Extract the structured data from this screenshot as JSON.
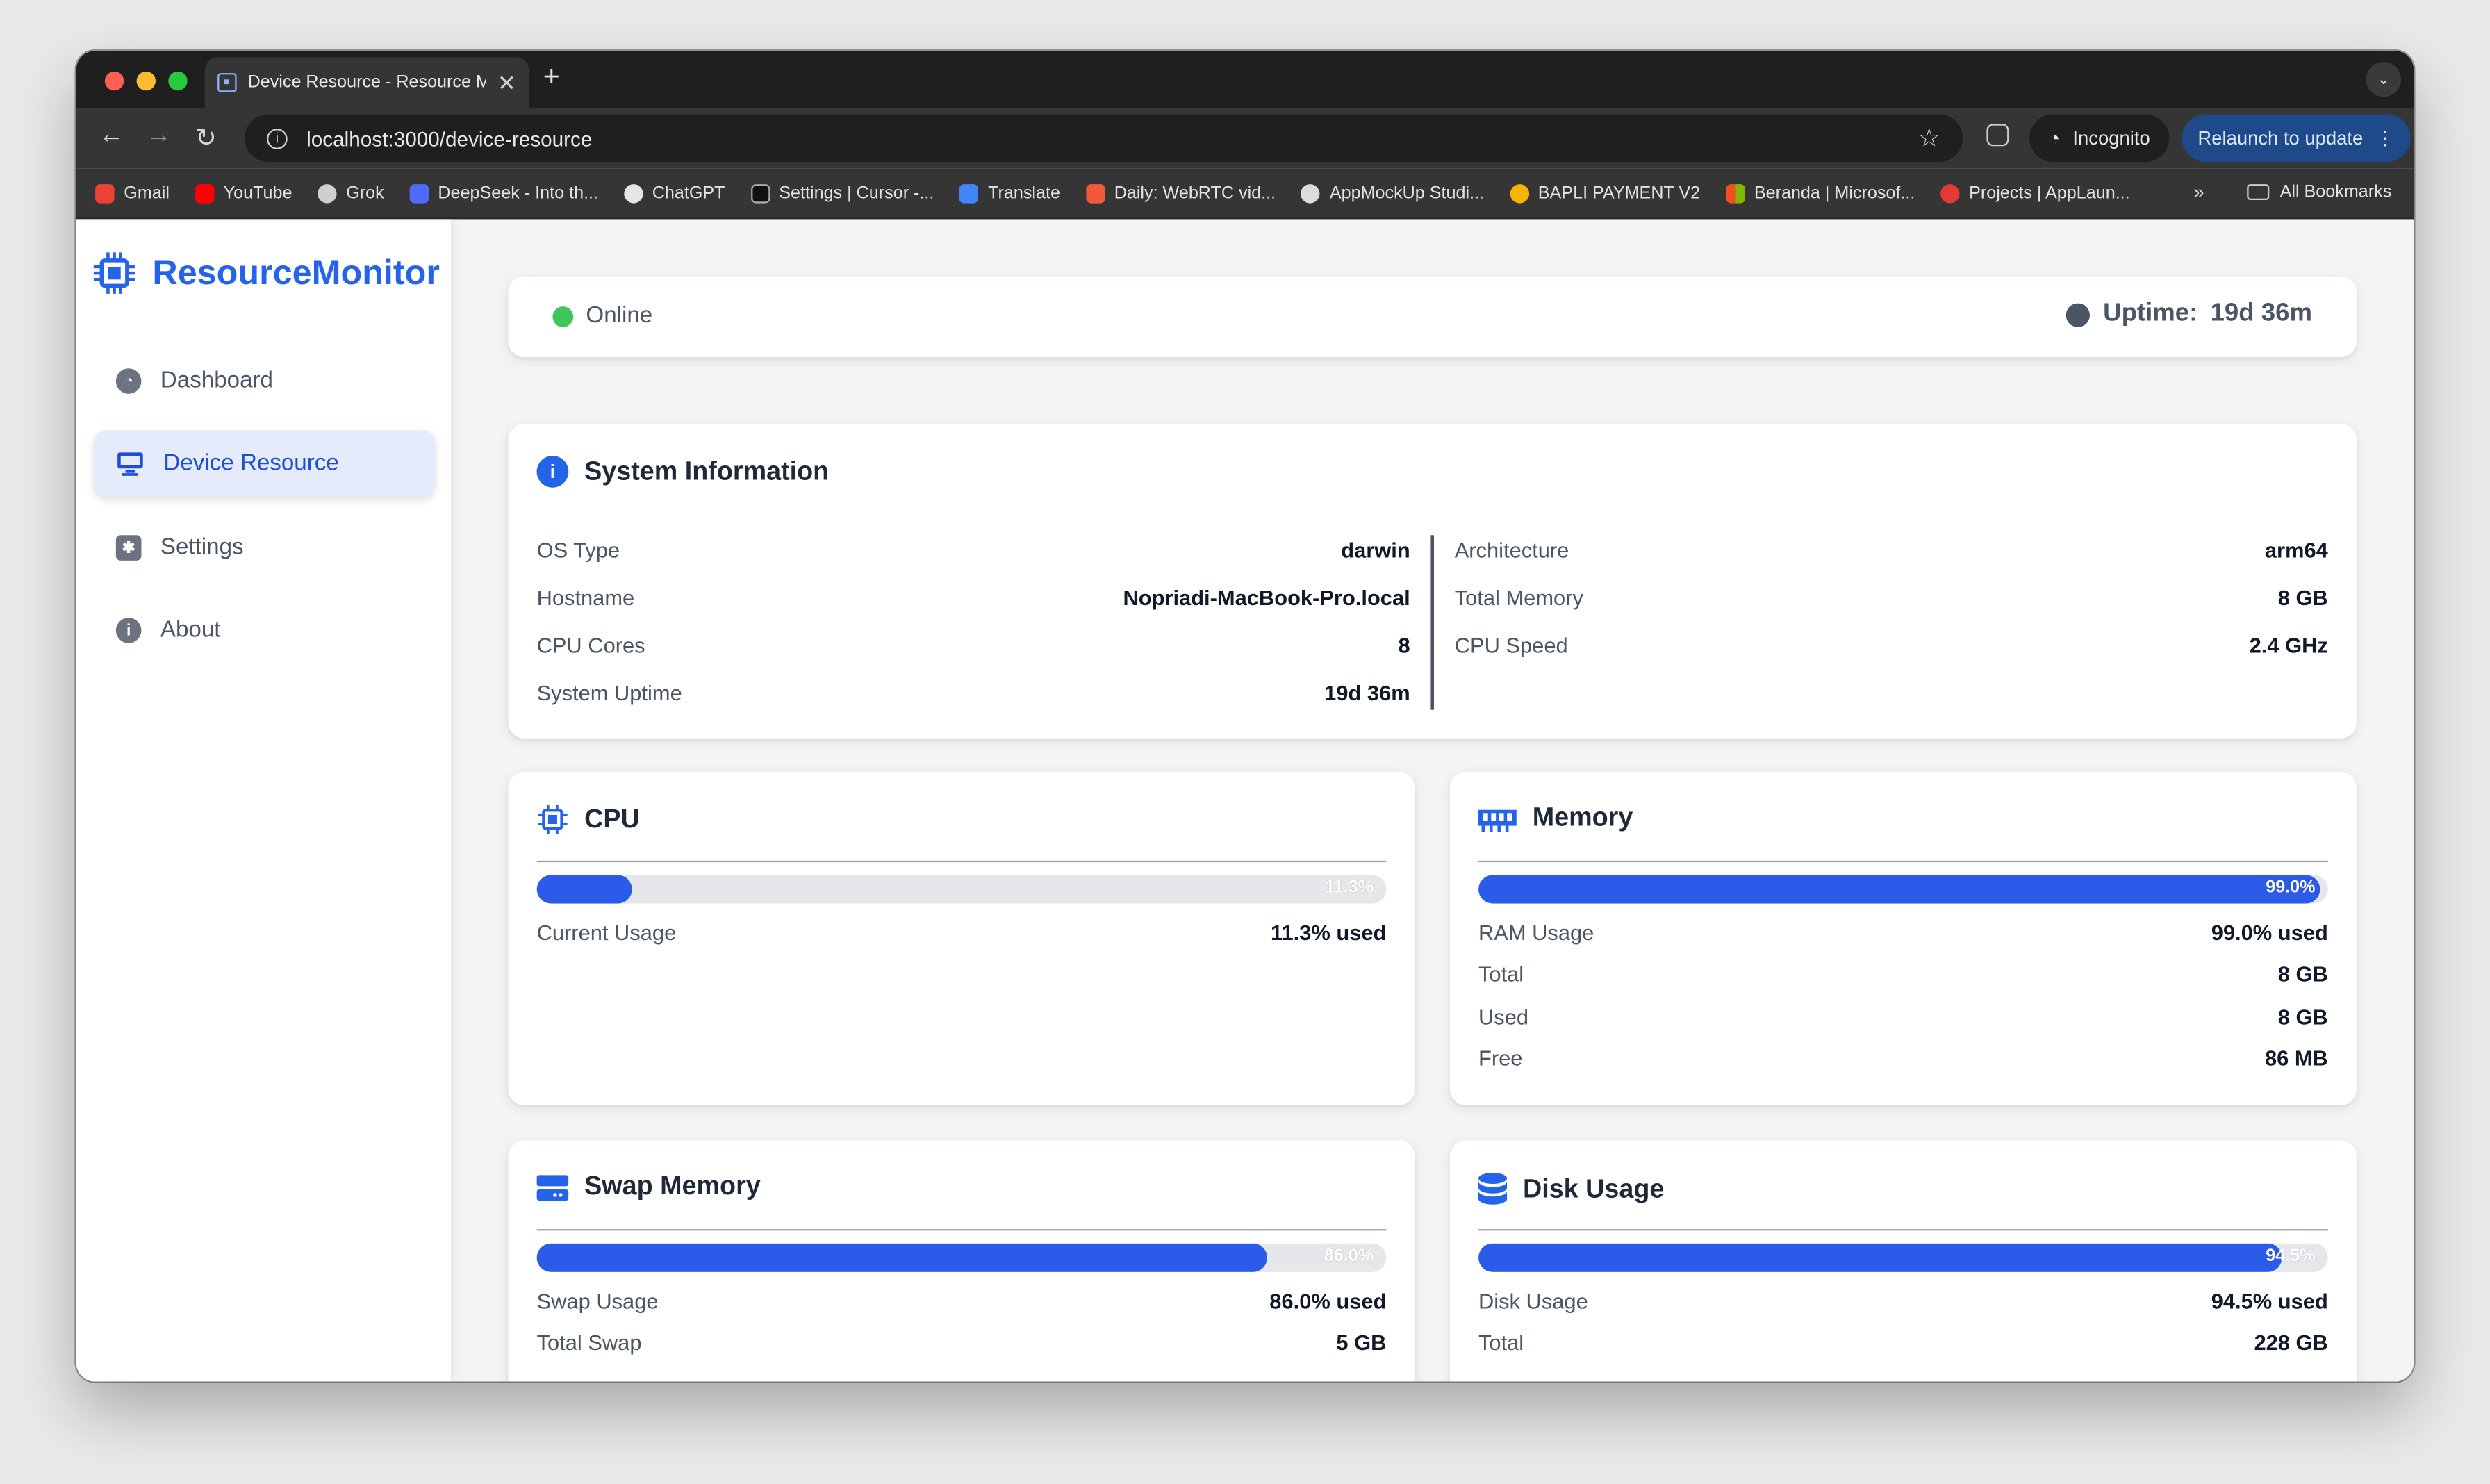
{
  "browser": {
    "tab_title": "Device Resource - Resource Monitor",
    "url": "localhost:3000/device-resource",
    "incognito_label": "Incognito",
    "relaunch_label": "Relaunch to update",
    "bookmarks": [
      "Gmail",
      "YouTube",
      "Grok",
      "DeepSeek - Into th...",
      "ChatGPT",
      "Settings | Cursor -...",
      "Translate",
      "Daily: WebRTC vid...",
      "AppMockUp Studi...",
      "BAPLI PAYMENT V2",
      "Beranda | Microsof...",
      "Projects | AppLaun..."
    ],
    "bookmarks_overflow": "»",
    "all_bookmarks": "All Bookmarks"
  },
  "sidebar": {
    "brand": "ResourceMonitor",
    "items": [
      {
        "label": "Dashboard",
        "icon": "gauge-icon"
      },
      {
        "label": "Device Resource",
        "icon": "monitor-icon",
        "active": true
      },
      {
        "label": "Settings",
        "icon": "gear-icon"
      },
      {
        "label": "About",
        "icon": "info-icon"
      }
    ]
  },
  "status": {
    "state": "Online",
    "uptime_label": "Uptime:",
    "uptime_value": "19d 36m"
  },
  "system": {
    "title": "System Information",
    "left": [
      {
        "label": "OS Type",
        "value": "darwin"
      },
      {
        "label": "Hostname",
        "value": "Nopriadi-MacBook-Pro.local"
      },
      {
        "label": "CPU Cores",
        "value": "8"
      },
      {
        "label": "System Uptime",
        "value": "19d 36m"
      }
    ],
    "right": [
      {
        "label": "Architecture",
        "value": "arm64"
      },
      {
        "label": "Total Memory",
        "value": "8 GB"
      },
      {
        "label": "CPU Speed",
        "value": "2.4 GHz"
      }
    ]
  },
  "cpu": {
    "title": "CPU",
    "percent": 11.3,
    "percent_label": "11.3%",
    "rows": [
      {
        "label": "Current Usage",
        "value": "11.3% used"
      }
    ]
  },
  "memory": {
    "title": "Memory",
    "percent": 99.0,
    "percent_label": "99.0%",
    "rows": [
      {
        "label": "RAM Usage",
        "value": "99.0% used"
      },
      {
        "label": "Total",
        "value": "8 GB"
      },
      {
        "label": "Used",
        "value": "8 GB"
      },
      {
        "label": "Free",
        "value": "86 MB"
      }
    ]
  },
  "swap": {
    "title": "Swap Memory",
    "percent": 86.0,
    "percent_label": "86.0%",
    "rows": [
      {
        "label": "Swap Usage",
        "value": "86.0% used"
      },
      {
        "label": "Total Swap",
        "value": "5 GB"
      }
    ]
  },
  "disk": {
    "title": "Disk Usage",
    "percent": 94.5,
    "percent_label": "94.5%",
    "rows": [
      {
        "label": "Disk Usage",
        "value": "94.5% used"
      },
      {
        "label": "Total",
        "value": "228 GB"
      }
    ]
  },
  "colors": {
    "accent": "#2563eb",
    "bar_fill": "#2c5ae9",
    "online": "#22c55e"
  }
}
